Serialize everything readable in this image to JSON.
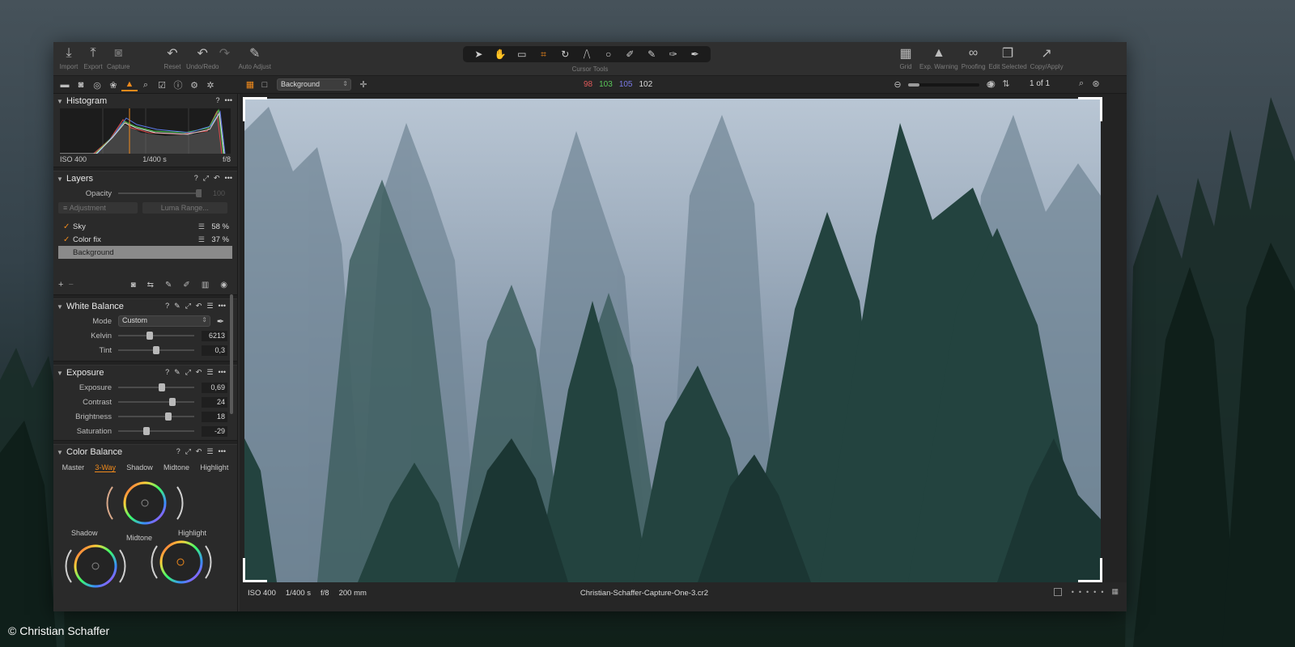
{
  "credit": "© Christian Schaffer",
  "toolbar": {
    "left": [
      {
        "icon": "import-icon",
        "glyph": "⤓",
        "label": "Import",
        "dim": false
      },
      {
        "icon": "export-icon",
        "glyph": "⤒",
        "label": "Export",
        "dim": false
      },
      {
        "icon": "camera-icon",
        "glyph": "◙",
        "label": "Capture",
        "dim": true
      }
    ],
    "edit": [
      {
        "icon": "reset-icon",
        "glyph": "↶",
        "label": "Reset",
        "dim": false
      },
      {
        "icon": "undo-icon",
        "glyph": "↶",
        "label": "Undo/Redo",
        "dim": false
      },
      {
        "icon": "redo-icon",
        "glyph": "↷",
        "label": "",
        "dim": true
      },
      {
        "icon": "magic-wand-icon",
        "glyph": "✎",
        "label": "Auto Adjust",
        "dim": false
      }
    ],
    "cursor_tools_label": "Cursor Tools",
    "right": [
      {
        "icon": "grid-icon",
        "glyph": "▦",
        "label": "Grid",
        "dim": false
      },
      {
        "icon": "warning-icon",
        "glyph": "▲",
        "label": "Exp. Warning",
        "dim": false
      },
      {
        "icon": "glasses-icon",
        "glyph": "∞",
        "label": "Proofing",
        "dim": false
      },
      {
        "icon": "edit-selected-icon",
        "glyph": "❐",
        "label": "Edit Selected",
        "dim": false
      },
      {
        "icon": "copy-apply-icon",
        "glyph": "↗",
        "label": "Copy/Apply",
        "dim": false
      }
    ]
  },
  "viewer_bar": {
    "layer": "Background",
    "rgb": {
      "r": "98",
      "g": "103",
      "b": "105",
      "l": "102"
    },
    "zoom_fraction": 0.16,
    "page_count": "1 of 1"
  },
  "histogram": {
    "title": "Histogram",
    "iso": "ISO 400",
    "shutter": "1/400 s",
    "aperture": "f/8"
  },
  "layers": {
    "title": "Layers",
    "opacity_label": "Opacity",
    "opacity_value": "100",
    "adjustment_label": "Adjustment",
    "luma_label": "Luma Range...",
    "items": [
      {
        "name": "Sky",
        "opacity": "58 %",
        "checked": true,
        "selected": false
      },
      {
        "name": "Color fix",
        "opacity": "37 %",
        "checked": true,
        "selected": false
      },
      {
        "name": "Background",
        "opacity": "",
        "checked": false,
        "selected": true
      }
    ]
  },
  "white_balance": {
    "title": "White Balance",
    "mode_label": "Mode",
    "mode_value": "Custom",
    "kelvin_label": "Kelvin",
    "kelvin_value": "6213",
    "kelvin_pos": 0.42,
    "tint_label": "Tint",
    "tint_value": "0,3",
    "tint_pos": 0.5
  },
  "exposure": {
    "title": "Exposure",
    "rows": [
      {
        "label": "Exposure",
        "value": "0,69",
        "pos": 0.57
      },
      {
        "label": "Contrast",
        "value": "24",
        "pos": 0.71
      },
      {
        "label": "Brightness",
        "value": "18",
        "pos": 0.66
      },
      {
        "label": "Saturation",
        "value": "-29",
        "pos": 0.37
      }
    ]
  },
  "color_balance": {
    "title": "Color Balance",
    "tabs": [
      "Master",
      "3-Way",
      "Shadow",
      "Midtone",
      "Highlight"
    ],
    "active_tab": "3-Way",
    "shadow_label": "Shadow",
    "midtone_label": "Midtone",
    "highlight_label": "Highlight"
  },
  "status": {
    "iso": "ISO 400",
    "shutter": "1/400 s",
    "aperture": "f/8",
    "focal": "200 mm",
    "filename": "Christian-Schaffer-Capture-One-3.cr2"
  }
}
